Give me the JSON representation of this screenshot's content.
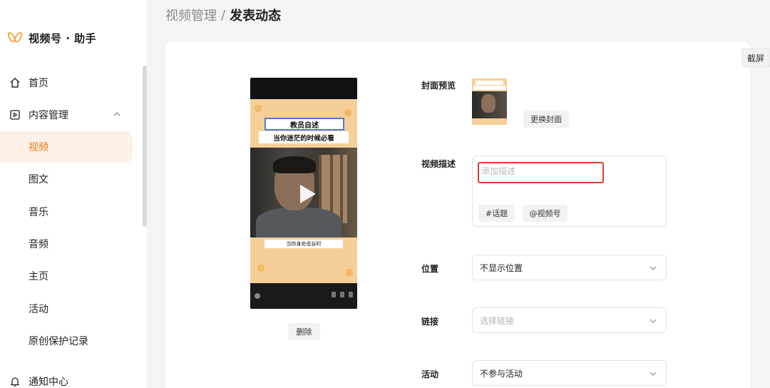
{
  "app": {
    "title": "视频号 · 助手"
  },
  "breadcrumb": {
    "parent": "视频管理",
    "separator": "/",
    "current": "发表动态"
  },
  "sidebar": {
    "items": [
      {
        "label": "首页",
        "icon": "home-icon"
      },
      {
        "label": "内容管理",
        "icon": "play-square-icon",
        "expanded": true
      },
      {
        "label": "视频",
        "active": true
      },
      {
        "label": "图文"
      },
      {
        "label": "音乐"
      },
      {
        "label": "音频"
      },
      {
        "label": "主页"
      },
      {
        "label": "活动"
      },
      {
        "label": "原创保护记录"
      },
      {
        "label": "通知中心",
        "icon": "bell-icon"
      }
    ]
  },
  "toolbar": {
    "screenshot_label": "截屏"
  },
  "video": {
    "title_overlay": "教员自述",
    "subtitle_overlay": "当你迷茫的时候必看",
    "caption_overlay": "当你身处低谷时",
    "delete_label": "删除"
  },
  "form": {
    "cover_label": "封面预览",
    "change_cover_label": "更换封面",
    "description_label": "视频描述",
    "description_placeholder": "添加描述",
    "topic_button": "#话题",
    "mention_button": "@视频号",
    "location_label": "位置",
    "location_value": "不显示位置",
    "link_label": "链接",
    "link_placeholder": "选择链接",
    "activity_label": "活动",
    "activity_value": "不参与活动"
  },
  "colors": {
    "accent": "#f07c1c",
    "active_bg": "#fdf1e7",
    "highlight_border": "#d9412f"
  }
}
